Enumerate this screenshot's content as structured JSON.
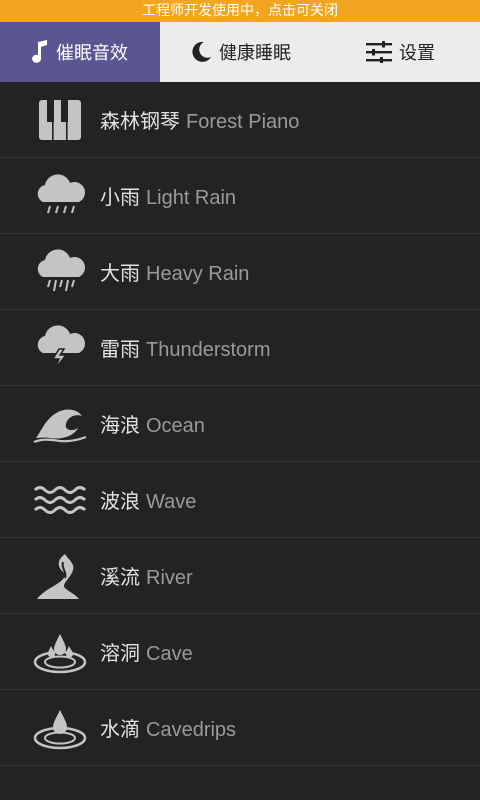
{
  "dev_banner": "工程师开发使用中，点击可关闭",
  "tabs": [
    {
      "label": "催眠音效",
      "icon": "music-note-icon",
      "active": true
    },
    {
      "label": "健康睡眠",
      "icon": "moon-icon",
      "active": false
    },
    {
      "label": "设置",
      "icon": "sliders-icon",
      "active": false
    }
  ],
  "colors": {
    "banner": "#f2a51e",
    "active_tab": "#5b5592",
    "tab_bar": "#ececec",
    "list_background": "#232323",
    "icon": "#c4c4c4"
  },
  "sounds": [
    {
      "zh": "森林钢琴",
      "en": "Forest Piano",
      "icon": "piano-icon"
    },
    {
      "zh": "小雨",
      "en": "Light Rain",
      "icon": "light-rain-icon"
    },
    {
      "zh": "大雨",
      "en": "Heavy Rain",
      "icon": "heavy-rain-icon"
    },
    {
      "zh": "雷雨",
      "en": "Thunderstorm",
      "icon": "thunderstorm-icon"
    },
    {
      "zh": "海浪",
      "en": "Ocean",
      "icon": "ocean-icon"
    },
    {
      "zh": "波浪",
      "en": "Wave",
      "icon": "wave-icon"
    },
    {
      "zh": "溪流",
      "en": "River",
      "icon": "river-icon"
    },
    {
      "zh": "溶洞",
      "en": "Cave",
      "icon": "cave-icon"
    },
    {
      "zh": "水滴",
      "en": "Cavedrips",
      "icon": "water-drop-icon"
    }
  ]
}
